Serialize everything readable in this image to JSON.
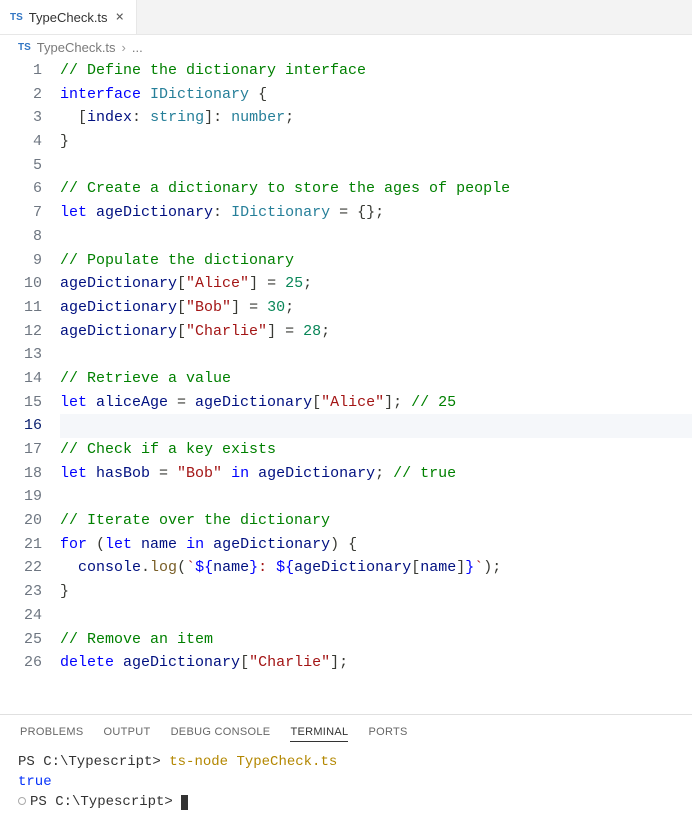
{
  "tab": {
    "icon_label": "TS",
    "filename": "TypeCheck.ts",
    "close": "×"
  },
  "breadcrumb": {
    "icon_label": "TS",
    "filename": "TypeCheck.ts",
    "chev": "›",
    "more": "..."
  },
  "gutter": {
    "lines": 26,
    "active_line": 16
  },
  "code": {
    "l1": {
      "comment": "// Define the dictionary interface"
    },
    "l2": {
      "kw1": "interface",
      "type": "IDictionary",
      "brace": " {"
    },
    "l3": {
      "indent": "  ",
      "b1": "[",
      "ident": "index",
      "colon": ": ",
      "t": "string",
      "b2": "]: ",
      "t2": "number",
      "semi": ";"
    },
    "l4": {
      "brace": "}"
    },
    "l6": {
      "comment": "// Create a dictionary to store the ages of people"
    },
    "l7": {
      "kw": "let",
      "id": " ageDictionary",
      "colon": ": ",
      "type": "IDictionary",
      "eq": " = {};"
    },
    "l9": {
      "comment": "// Populate the dictionary"
    },
    "l10": {
      "id": "ageDictionary",
      "b1": "[",
      "str": "\"Alice\"",
      "b2": "] = ",
      "num": "25",
      "semi": ";"
    },
    "l11": {
      "id": "ageDictionary",
      "b1": "[",
      "str": "\"Bob\"",
      "b2": "] = ",
      "num": "30",
      "semi": ";"
    },
    "l12": {
      "id": "ageDictionary",
      "b1": "[",
      "str": "\"Charlie\"",
      "b2": "] = ",
      "num": "28",
      "semi": ";"
    },
    "l14": {
      "comment": "// Retrieve a value"
    },
    "l15": {
      "kw": "let",
      "id": " aliceAge",
      "eq": " = ",
      "id2": "ageDictionary",
      "b1": "[",
      "str": "\"Alice\"",
      "b2": "]; ",
      "comment": "// 25"
    },
    "l17": {
      "comment": "// Check if a key exists"
    },
    "l18": {
      "kw": "let",
      "id": " hasBob",
      "eq": " = ",
      "str": "\"Bob\"",
      "kw2": " in ",
      "id2": "ageDictionary",
      "semi": "; ",
      "comment": "// true"
    },
    "l20": {
      "comment": "// Iterate over the dictionary"
    },
    "l21": {
      "kw": "for",
      "p1": " (",
      "kw2": "let",
      "id": " name",
      "kw3": " in ",
      "id2": "ageDictionary",
      "p2": ") {"
    },
    "l22": {
      "indent": "  ",
      "obj": "console",
      "dot": ".",
      "fn": "log",
      "p1": "(",
      "tick1": "`",
      "tpl1": "${",
      "id": "name",
      "tpl1e": "}",
      "colon": ": ",
      "tpl2": "${",
      "id2": "ageDictionary",
      "b1": "[",
      "id3": "name",
      "b2": "]",
      "tpl2e": "}",
      "tick2": "`",
      "p2": ");"
    },
    "l23": {
      "brace": "}"
    },
    "l25": {
      "comment": "// Remove an item"
    },
    "l26": {
      "kw": "delete",
      "sp": " ",
      "id": "ageDictionary",
      "b1": "[",
      "str": "\"Charlie\"",
      "b2": "];"
    }
  },
  "panel": {
    "tabs": {
      "problems": "PROBLEMS",
      "output": "OUTPUT",
      "debug": "DEBUG CONSOLE",
      "terminal": "TERMINAL",
      "ports": "PORTS"
    }
  },
  "terminal": {
    "line1": {
      "prompt": "PS C:\\Typescript> ",
      "cmd": "ts-node TypeCheck.ts"
    },
    "line2": {
      "out": "true"
    },
    "line3": {
      "prompt": "PS C:\\Typescript> "
    }
  }
}
